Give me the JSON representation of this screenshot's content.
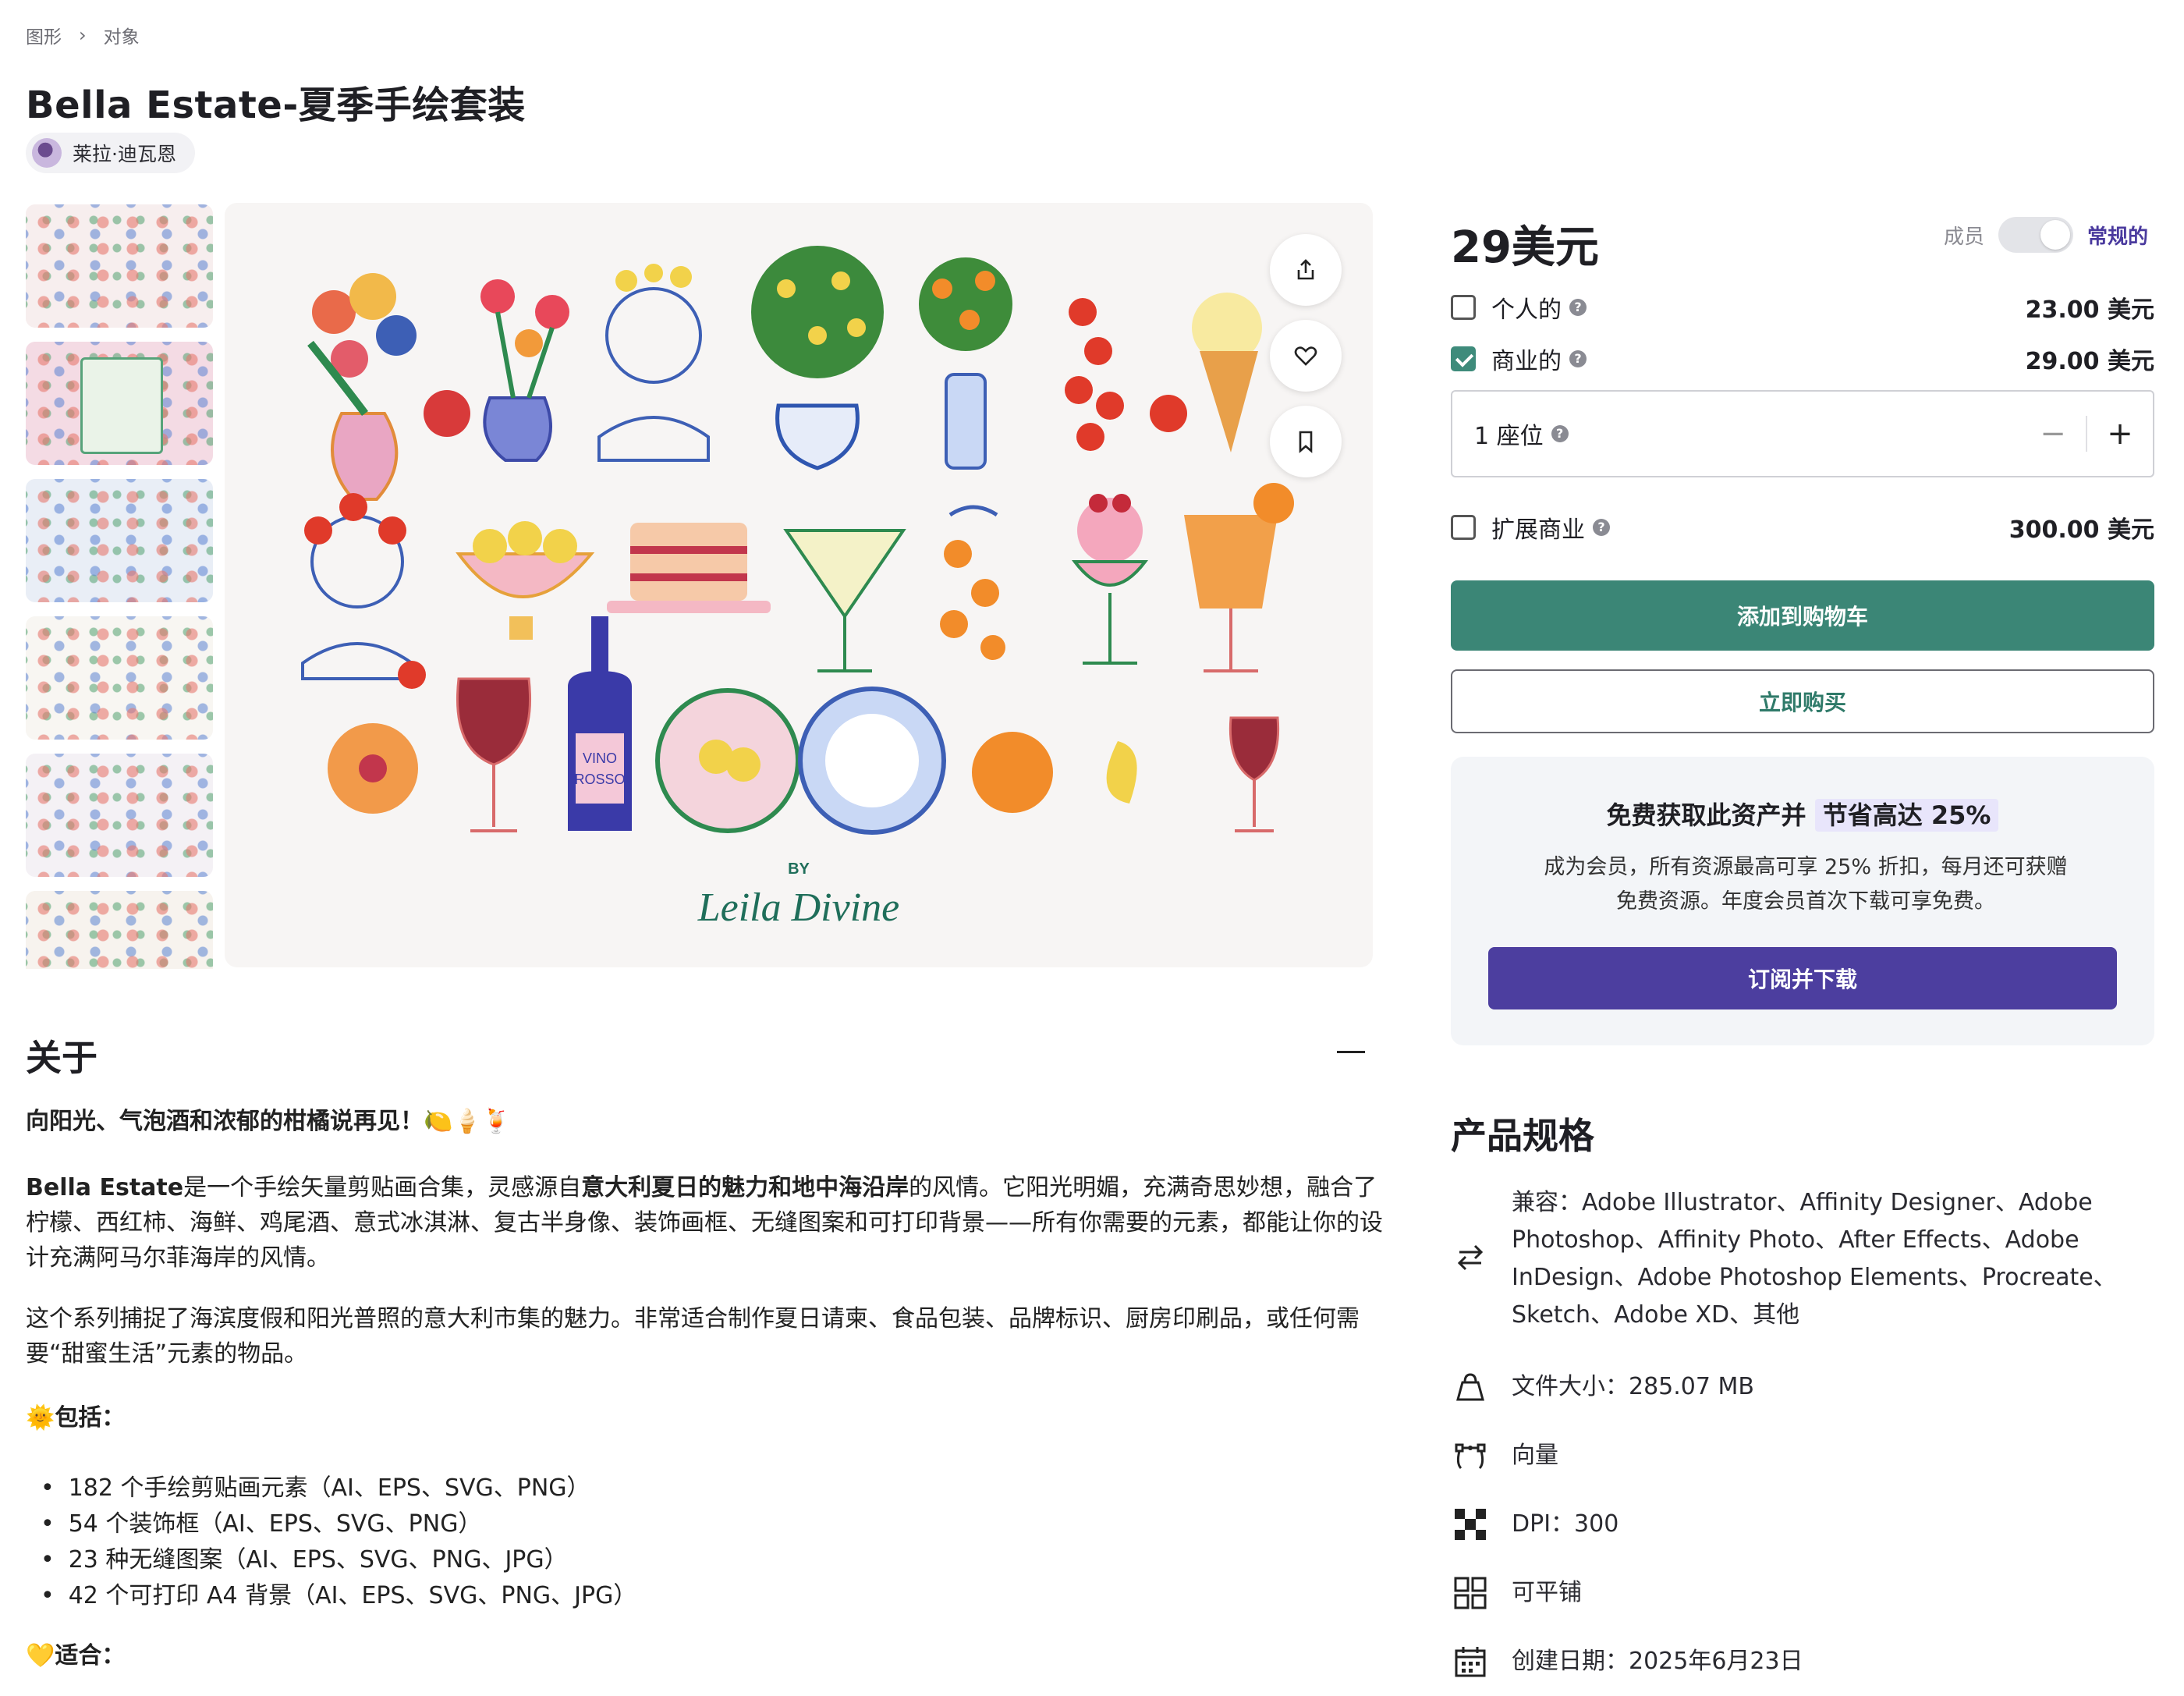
{
  "breadcrumb": [
    "图形",
    "对象"
  ],
  "product": {
    "title": "Bella Estate-夏季手绘套装",
    "author": "莱拉·迪瓦恩"
  },
  "preview": {
    "thumbnails": [
      "thumb-1",
      "thumb-2",
      "thumb-3",
      "thumb-4",
      "thumb-5",
      "thumb-6"
    ],
    "signature_by": "BY",
    "signature_name": "Leila Divine",
    "bottle_label_1": "VINO",
    "bottle_label_2": "ROSSO"
  },
  "about": {
    "heading": "关于",
    "tagline": "向阳光、气泡酒和浓郁的柑橘说再见！🍋🍦🍹",
    "para1_name": "Bella Estate",
    "para1_a": "是一个手绘矢量剪贴画合集，灵感源自",
    "para1_bold": "意大利夏日的魅力和地中海沿岸",
    "para1_b": "的风情。它阳光明媚，充满奇思妙想，融合了柠檬、西红柿、海鲜、鸡尾酒、意式冰淇淋、复古半身像、装饰画框、无缝图案和可打印背景——所有你需要的元素，都能让你的设计充满阿马尔菲海岸的风情。",
    "para2": "这个系列捕捉了海滨度假和阳光普照的意大利市集的魅力。非常适合制作夏日请柬、食品包装、品牌标识、厨房印刷品，或任何需要“甜蜜生活”元素的物品。",
    "includes_heading": "🌞包括：",
    "includes": [
      "182 个手绘剪贴画元素（AI、EPS、SVG、PNG）",
      "54 个装饰框（AI、EPS、SVG、PNG）",
      "23 种无缝图案（AI、EPS、SVG、PNG、JPG）",
      "42 个可打印 A4 背景（AI、EPS、SVG、PNG、JPG）"
    ],
    "suits_heading": "💛适合："
  },
  "purchase": {
    "price": "29美元",
    "toggle_left": "成员",
    "toggle_right": "常规的",
    "options": [
      {
        "label": "个人的",
        "amount": "23.00 美元",
        "checked": false
      },
      {
        "label": "商业的",
        "amount": "29.00 美元",
        "checked": true
      }
    ],
    "seat_label": "1 座位",
    "seat_minus": "−",
    "seat_plus": "+",
    "extended": {
      "label": "扩展商业",
      "amount": "300.00 美元",
      "checked": false
    },
    "add_to_cart": "添加到购物车",
    "buy_now": "立即购买",
    "help_glyph": "?"
  },
  "promo": {
    "heading_a": "免费获取此资产并",
    "heading_hl": "节省高达 25%",
    "body": "成为会员，所有资源最高可享 25% 折扣，每月还可获赠免费资源。年度会员首次下载可享免费。",
    "button": "订阅并下载"
  },
  "specs": {
    "heading": "产品规格",
    "items": [
      {
        "icon": "swap-arrows-icon",
        "text": "兼容：Adobe Illustrator、Affinity Designer、Adobe Photoshop、Affinity Photo、After Effects、Adobe InDesign、Adobe Photoshop Elements、Procreate、Sketch、Adobe XD、其他"
      },
      {
        "icon": "bag-icon",
        "text": "文件大小：285.07 MB"
      },
      {
        "icon": "vector-icon",
        "text": "向量"
      },
      {
        "icon": "dpi-grid-icon",
        "text": "DPI：300"
      },
      {
        "icon": "tile-grid-icon",
        "text": "可平铺"
      },
      {
        "icon": "calendar-icon",
        "text": "创建日期：2025年6月23日"
      }
    ]
  },
  "colors": {
    "teal": "#3b8676",
    "purple": "#4c3e9f",
    "accent_text": "#4a3a9e"
  }
}
